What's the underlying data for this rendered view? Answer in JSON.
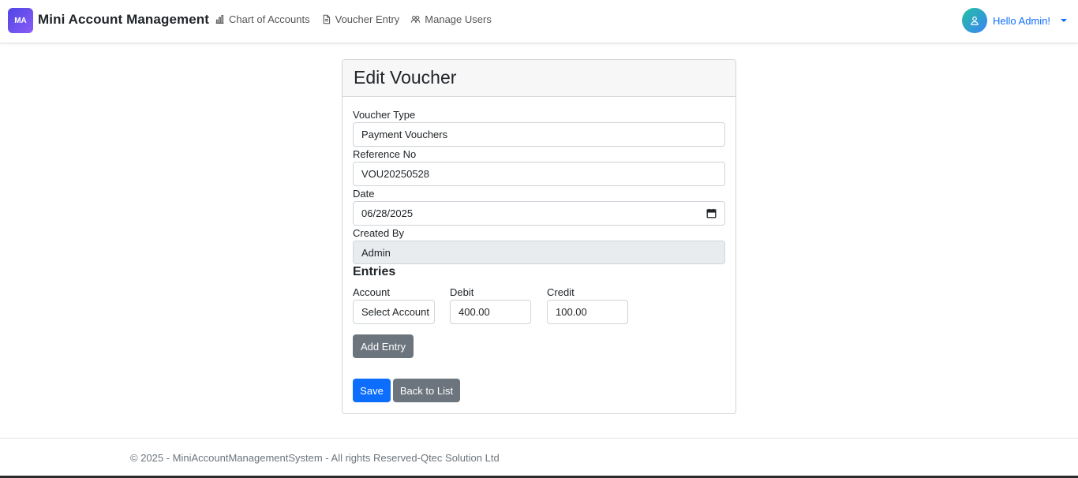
{
  "brand": {
    "logo_text": "MA",
    "name": "Mini Account Management"
  },
  "nav": {
    "items": [
      {
        "label": "Chart of Accounts",
        "icon": "bar-chart-icon"
      },
      {
        "label": "Voucher Entry",
        "icon": "document-icon"
      },
      {
        "label": "Manage Users",
        "icon": "users-icon"
      }
    ]
  },
  "user": {
    "greeting": "Hello Admin!",
    "icon": "user-icon"
  },
  "form": {
    "title": "Edit Voucher",
    "voucher_type": {
      "label": "Voucher Type",
      "value": "Payment Vouchers"
    },
    "reference_no": {
      "label": "Reference No",
      "value": "VOU20250528"
    },
    "date": {
      "label": "Date",
      "value": "06/28/2025"
    },
    "created_by": {
      "label": "Created By",
      "value": "Admin"
    },
    "entries": {
      "heading": "Entries",
      "columns": {
        "account": "Account",
        "debit": "Debit",
        "credit": "Credit"
      },
      "rows": [
        {
          "account": "Select Account",
          "debit": "400.00",
          "credit": "100.00"
        }
      ],
      "add_button": "Add Entry"
    },
    "save_button": "Save",
    "back_button": "Back to List"
  },
  "footer": {
    "text": "© 2025 - MiniAccountManagementSystem - All rights Reserved-Qtec Solution Ltd"
  },
  "colors": {
    "primary": "#0d6efd",
    "secondary": "#6c757d",
    "brand_gradient_start": "#4f46e5",
    "brand_gradient_end": "#8b5cf6"
  }
}
